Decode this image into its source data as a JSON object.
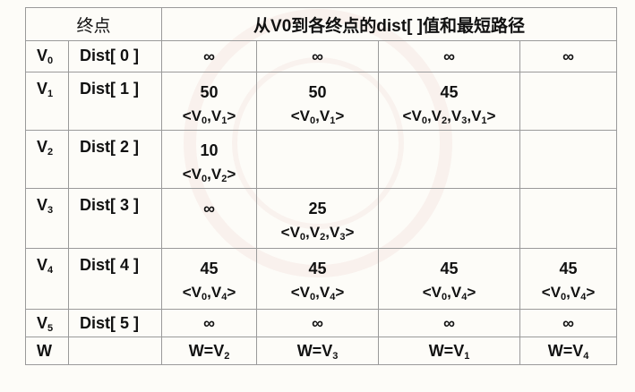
{
  "header": {
    "col_endpoint": "终点",
    "col_title": "从V0到各终点的dist[ ]值和最短路径"
  },
  "rows": [
    {
      "v": "V",
      "vsub": "0",
      "dist": "Dist[ 0 ]",
      "cells": [
        {
          "val": "∞",
          "path": []
        },
        {
          "val": "∞",
          "path": []
        },
        {
          "val": "∞",
          "path": []
        },
        {
          "val": "∞",
          "path": []
        }
      ]
    },
    {
      "v": "V",
      "vsub": "1",
      "dist": "Dist[ 1 ]",
      "cells": [
        {
          "val": "50",
          "path": [
            "0",
            "1"
          ]
        },
        {
          "val": "50",
          "path": [
            "0",
            "1"
          ]
        },
        {
          "val": "45",
          "path": [
            "0",
            "2",
            "3",
            "1"
          ]
        },
        {
          "val": "",
          "path": []
        }
      ]
    },
    {
      "v": "V",
      "vsub": "2",
      "dist": "Dist[ 2 ]",
      "cells": [
        {
          "val": "10",
          "path": [
            "0",
            "2"
          ]
        },
        {
          "val": "",
          "path": []
        },
        {
          "val": "",
          "path": []
        },
        {
          "val": "",
          "path": []
        }
      ]
    },
    {
      "v": "V",
      "vsub": "3",
      "dist": "Dist[ 3 ]",
      "cells": [
        {
          "val": "∞",
          "path": []
        },
        {
          "val": "25",
          "path": [
            "0",
            "2",
            "3"
          ]
        },
        {
          "val": "",
          "path": []
        },
        {
          "val": "",
          "path": []
        }
      ]
    },
    {
      "v": "V",
      "vsub": "4",
      "dist": "Dist[ 4 ]",
      "cells": [
        {
          "val": "45",
          "path": [
            "0",
            "4"
          ]
        },
        {
          "val": "45",
          "path": [
            "0",
            "4"
          ]
        },
        {
          "val": "45",
          "path": [
            "0",
            "4"
          ]
        },
        {
          "val": "45",
          "path": [
            "0",
            "4"
          ]
        }
      ]
    },
    {
      "v": "V",
      "vsub": "5",
      "dist": "Dist[ 5 ]",
      "cells": [
        {
          "val": "∞",
          "path": []
        },
        {
          "val": "∞",
          "path": []
        },
        {
          "val": "∞",
          "path": []
        },
        {
          "val": "∞",
          "path": []
        }
      ]
    }
  ],
  "w_row": {
    "label": "W",
    "prefix": "W=V",
    "subs": [
      "2",
      "3",
      "1",
      "4"
    ]
  }
}
